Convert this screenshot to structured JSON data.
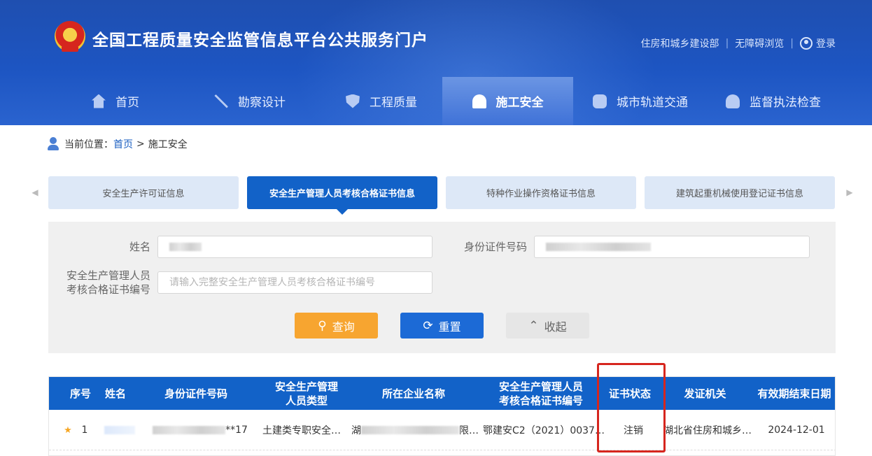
{
  "header": {
    "site_title": "全国工程质量安全监管信息平台公共服务门户",
    "links": [
      "住房和城乡建设部",
      "无障碍浏览"
    ],
    "login": "登录"
  },
  "nav": [
    {
      "label": "首页",
      "icon": "home-icon"
    },
    {
      "label": "勘察设计",
      "icon": "tools-icon"
    },
    {
      "label": "工程质量",
      "icon": "shield-icon"
    },
    {
      "label": "施工安全",
      "icon": "worker-icon",
      "active": true
    },
    {
      "label": "城市轨道交通",
      "icon": "train-icon"
    },
    {
      "label": "监督执法检查",
      "icon": "police-cap-icon"
    }
  ],
  "breadcrumb": {
    "prefix": "当前位置：",
    "home": "首页",
    "separator": ">",
    "current": "施工安全"
  },
  "tabs": [
    "安全生产许可证信息",
    "安全生产管理人员考核合格证书信息",
    "特种作业操作资格证书信息",
    "建筑起重机械使用登记证书信息"
  ],
  "form": {
    "name_label": "姓名",
    "id_label": "身份证件号码",
    "cert_label_line1": "安全生产管理人员",
    "cert_label_line2": "考核合格证书编号",
    "cert_placeholder": "请输入完整安全生产管理人员考核合格证书编号",
    "query": "查询",
    "reset": "重置",
    "fold": "收起"
  },
  "table": {
    "headers": {
      "index": "序号",
      "name": "姓名",
      "id": "身份证件号码",
      "type1": "安全生产管理",
      "type2": "人员类型",
      "company": "所在企业名称",
      "cert1": "安全生产管理人员",
      "cert2": "考核合格证书编号",
      "status": "证书状态",
      "issuer": "发证机关",
      "expiry": "有效期结束日期"
    },
    "rows": [
      {
        "index": "1",
        "id_suffix": "**17",
        "type": "土建类专职安全…",
        "company_prefix": "湖",
        "company_suffix": "限…",
        "cert": "鄂建安C2（2021）0037…",
        "status": "注销",
        "issuer": "湖北省住房和城乡…",
        "expiry": "2024-12-01"
      }
    ]
  },
  "colors": {
    "header_blue": "#1d55c2",
    "accent": "#1262c8",
    "query": "#f7a530",
    "highlight": "#d6261e"
  }
}
